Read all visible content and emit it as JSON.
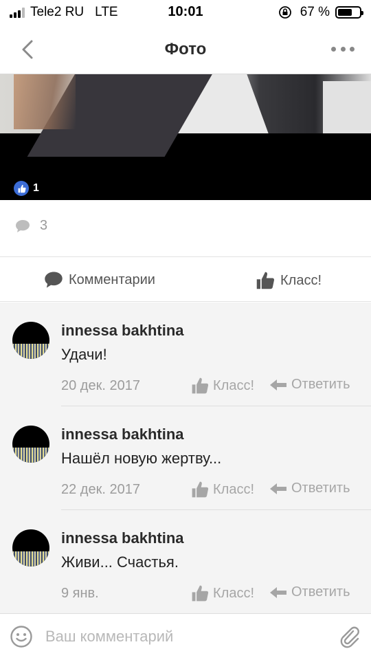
{
  "status_bar": {
    "carrier": "Tele2 RU",
    "network": "LTE",
    "time": "10:01",
    "battery": "67 %",
    "battery_level": 0.67
  },
  "nav": {
    "title": "Фото",
    "back_icon": "chevron-left-icon",
    "more_icon": "more-dots-icon"
  },
  "photo": {
    "likes_count": "1"
  },
  "stats": {
    "comments_count": "3"
  },
  "actions": {
    "comments_label": "Комментарии",
    "klass_label": "Класс!"
  },
  "comments": [
    {
      "author": "innessa bakhtina",
      "text": "Удачи!",
      "date": "20 дек. 2017",
      "klass": "Класс!",
      "reply": "Ответить"
    },
    {
      "author": "innessa bakhtina",
      "text": "Нашёл новую жертву...",
      "date": "22 дек. 2017",
      "klass": "Класс!",
      "reply": "Ответить"
    },
    {
      "author": "innessa bakhtina",
      "text": "Живи... Счастья.",
      "date": "9 янв.",
      "klass": "Класс!",
      "reply": "Ответить"
    }
  ],
  "input": {
    "placeholder": "Ваш комментарий",
    "value": ""
  },
  "colors": {
    "accent_like": "#3b6cd6",
    "muted_text": "#9c9c9c",
    "comments_bg": "#f4f4f4"
  }
}
